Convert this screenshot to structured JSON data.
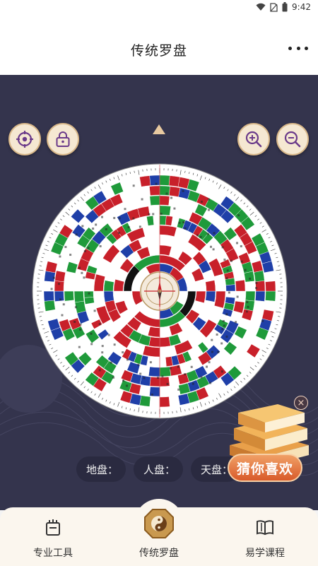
{
  "status_bar": {
    "time": "9:42"
  },
  "header": {
    "title": "传统罗盘"
  },
  "plates": [
    {
      "label": "地盘：",
      "value": ""
    },
    {
      "label": "人盘：",
      "value": ""
    },
    {
      "label": "天盘：",
      "value": ""
    }
  ],
  "promo": {
    "label": "猜你喜欢",
    "close": "×"
  },
  "bottom_nav": [
    {
      "label": "专业工具",
      "icon": "toolbox-icon"
    },
    {
      "label": "传统罗盘",
      "icon": "yin-yang-icon",
      "active": true
    },
    {
      "label": "易学课程",
      "icon": "book-icon"
    }
  ],
  "colors": {
    "main_bg": "#34344d",
    "accent": "#d9b88a",
    "nav_bg": "#fbf6ee",
    "compass_red": "#c8202a",
    "compass_blue": "#1f3fa8",
    "compass_green": "#1f9a3a"
  }
}
